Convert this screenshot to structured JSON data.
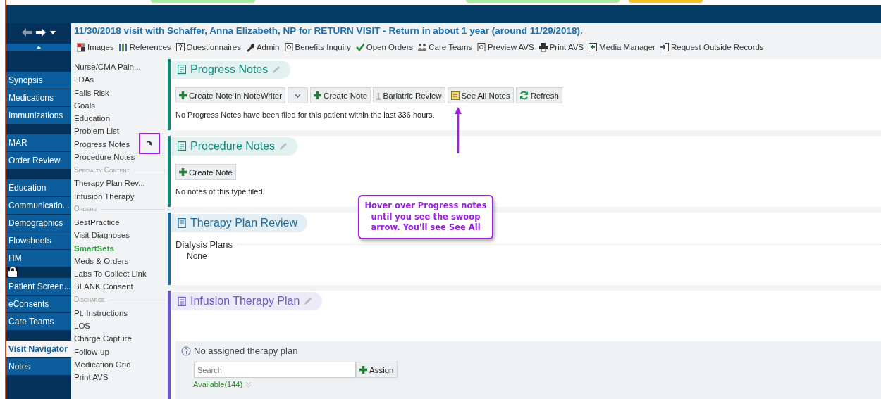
{
  "top_tabs": [
    {
      "color": "#a8eea0"
    },
    {
      "color": "#a8eea0"
    },
    {
      "color": "#f7c12a"
    }
  ],
  "sidebar": {
    "groups": [
      {
        "items": [
          {
            "label": "Synopsis",
            "selected": false
          },
          {
            "label": "Medications",
            "selected": false
          },
          {
            "label": "Immunizations",
            "selected": false
          }
        ]
      },
      {
        "items": [
          {
            "label": "MAR",
            "selected": false
          },
          {
            "label": "Order Review",
            "selected": false
          }
        ]
      },
      {
        "items": [
          {
            "label": "Education",
            "selected": false
          },
          {
            "label": "Communicatio...",
            "selected": false
          },
          {
            "label": "Demographics",
            "selected": false
          },
          {
            "label": "Flowsheets",
            "selected": false
          },
          {
            "label": "HM",
            "selected": false
          }
        ]
      },
      {
        "items": [
          {
            "label": "Patient Screen...",
            "selected": false
          },
          {
            "label": "eConsents",
            "selected": false
          },
          {
            "label": "Care Teams",
            "selected": false
          }
        ]
      },
      {
        "items": [
          {
            "label": "Visit Navigator",
            "selected": true
          },
          {
            "label": "Notes",
            "selected": false
          }
        ]
      }
    ]
  },
  "header": {
    "title": "11/30/2018 visit with Schaffer, Anna Elizabeth, NP for RETURN VISIT - Return in about 1 year (around 11/29/2018).",
    "toolbar": [
      {
        "kind": "images",
        "label": "Images"
      },
      {
        "kind": "references",
        "label": "References"
      },
      {
        "kind": "questionnaires",
        "label": "Questionnaires"
      },
      {
        "kind": "admin",
        "label": "Admin"
      },
      {
        "kind": "inquiry",
        "label": "Benefits Inquiry"
      },
      {
        "kind": "orders",
        "label": "Open Orders"
      },
      {
        "kind": "team",
        "label": "Care Teams"
      },
      {
        "kind": "inquiry",
        "label": "Preview AVS"
      },
      {
        "kind": "print",
        "label": "Print AVS"
      },
      {
        "kind": "media",
        "label": "Media Manager"
      },
      {
        "kind": "request",
        "label": "Request Outside Records"
      }
    ]
  },
  "navigator": [
    {
      "kind": "item",
      "label": "Nurse/CMA Pain...",
      "swoop_arrow": false
    },
    {
      "kind": "item",
      "label": "LDAs",
      "swoop_arrow": false
    },
    {
      "kind": "item",
      "label": "Falls Risk",
      "swoop_arrow": false
    },
    {
      "kind": "item",
      "label": "Goals",
      "swoop_arrow": false
    },
    {
      "kind": "item",
      "label": "Education",
      "swoop_arrow": false
    },
    {
      "kind": "item",
      "label": "Problem List",
      "swoop_arrow": false
    },
    {
      "kind": "item",
      "label": "Progress Notes",
      "swoop_arrow": true
    },
    {
      "kind": "item",
      "label": "Procedure Notes",
      "swoop_arrow": false
    },
    {
      "kind": "heading",
      "label": "Specialty Content",
      "swoop_arrow": false
    },
    {
      "kind": "item",
      "label": "Therapy Plan Rev...",
      "swoop_arrow": false
    },
    {
      "kind": "item",
      "label": "Infusion Therapy",
      "swoop_arrow": false
    },
    {
      "kind": "heading",
      "label": "Orders",
      "swoop_arrow": false
    },
    {
      "kind": "item",
      "label": "BestPractice",
      "swoop_arrow": false
    },
    {
      "kind": "item",
      "label": "Visit Diagnoses",
      "swoop_arrow": false
    },
    {
      "kind": "featured",
      "label": "SmartSets",
      "swoop_arrow": false
    },
    {
      "kind": "item",
      "label": "Meds & Orders",
      "swoop_arrow": false
    },
    {
      "kind": "item",
      "label": "Labs To Collect Link",
      "swoop_arrow": false
    },
    {
      "kind": "item",
      "label": "BLANK Consent",
      "swoop_arrow": false
    },
    {
      "kind": "heading",
      "label": "Discharge",
      "swoop_arrow": false
    },
    {
      "kind": "item",
      "label": "Pt. Instructions",
      "swoop_arrow": false
    },
    {
      "kind": "item",
      "label": "LOS",
      "swoop_arrow": false
    },
    {
      "kind": "item",
      "label": "Charge Capture",
      "swoop_arrow": false
    },
    {
      "kind": "item",
      "label": "Follow-up",
      "swoop_arrow": false
    },
    {
      "kind": "item",
      "label": "Medication Grid",
      "swoop_arrow": false
    },
    {
      "kind": "item",
      "label": "Print AVS",
      "swoop_arrow": false
    }
  ],
  "sections": [
    {
      "kind": "notes",
      "title": "Progress Notes",
      "color": "#13897a",
      "editable": true,
      "buttons": [
        {
          "kind": "add",
          "label": "Create Note in NoteWriter"
        },
        {
          "kind": "dropdown"
        },
        {
          "kind": "add",
          "label": "Create Note"
        },
        {
          "kind": "count",
          "count": "1",
          "label": "Bariatric Review"
        },
        {
          "kind": "notes",
          "label": "See All Notes"
        },
        {
          "kind": "refresh",
          "label": "Refresh"
        }
      ],
      "message": "No Progress Notes have been filed for this patient within the last 336 hours."
    },
    {
      "kind": "notes",
      "title": "Procedure Notes",
      "color": "#13897a",
      "editable": true,
      "buttons": [
        {
          "kind": "add",
          "label": "Create Note"
        }
      ],
      "message": "No notes of this type filed."
    },
    {
      "kind": "review",
      "title": "Therapy Plan Review",
      "color": "#1b6ca3",
      "editable": false,
      "subheading": "Dialysis Plans",
      "value": "None"
    },
    {
      "kind": "plan",
      "title": "Infusion Therapy Plan",
      "color": "#6e57c9",
      "editable": true,
      "panel": {
        "message": "No assigned therapy plan",
        "search": {
          "placeholder": "Search"
        },
        "assign": "Assign",
        "available": "Available(144)"
      }
    }
  ],
  "annotation": {
    "callout": "Hover over Progress notes until you see the swoop arrow.  You'll see See All"
  }
}
